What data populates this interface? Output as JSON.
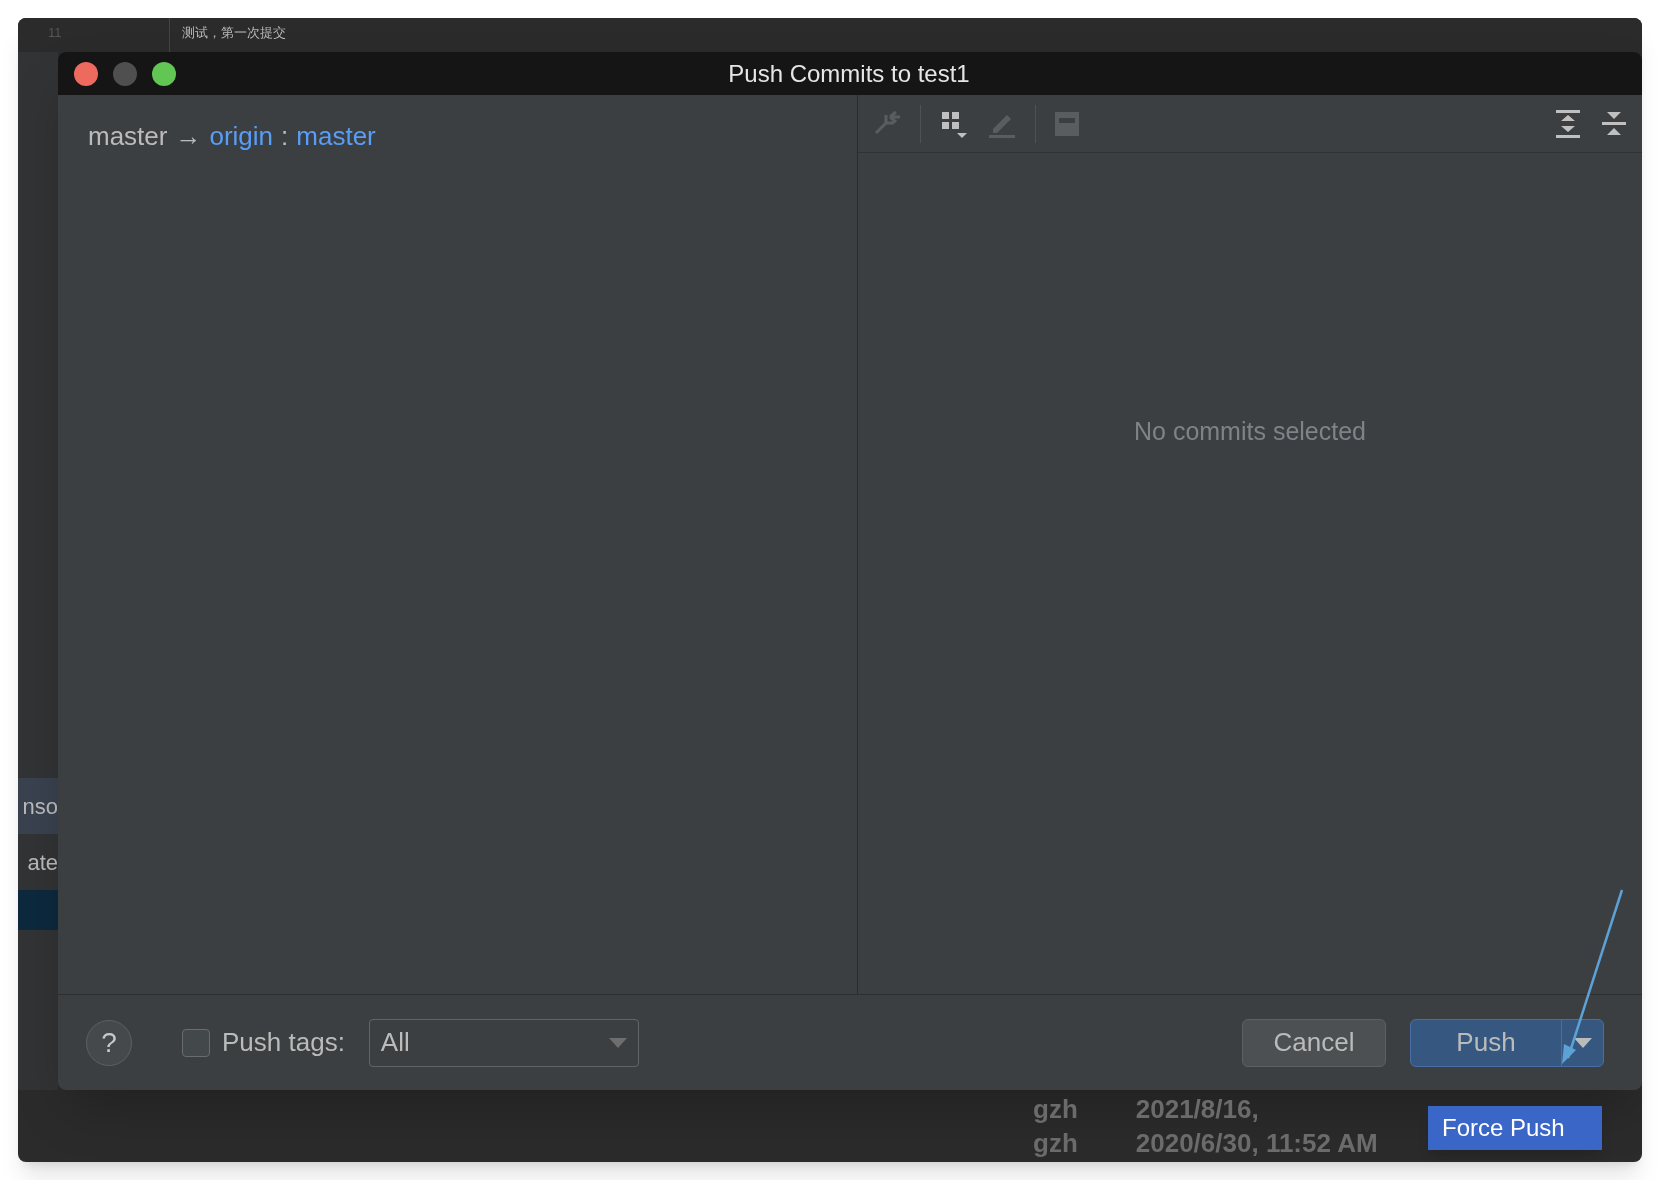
{
  "editor": {
    "line_number": "11",
    "text": "测试，第一次提交"
  },
  "side_panel": {
    "items": [
      {
        "label": "nso"
      },
      {
        "label": "ate"
      }
    ]
  },
  "dialog": {
    "title": "Push Commits to test1",
    "branch": {
      "local": "master",
      "arrow": "→",
      "remote": "origin",
      "separator": ":",
      "remote_branch": "master"
    },
    "details": {
      "empty_text": "No commits selected"
    },
    "footer": {
      "help": "?",
      "push_tags": {
        "label": "Push tags:",
        "checked": false
      },
      "tags_select": {
        "value": "All"
      },
      "buttons": [
        {
          "label": "Cancel",
          "kind": "default"
        },
        {
          "label": "Push",
          "kind": "primary"
        }
      ],
      "menu": [
        {
          "label": "Force Push",
          "selected": true
        }
      ]
    }
  },
  "log": {
    "rows": [
      {
        "author": "gzh",
        "date": "2021/8/16,"
      },
      {
        "author": "gzh",
        "date": "2020/6/30, 11:52 AM"
      }
    ]
  }
}
